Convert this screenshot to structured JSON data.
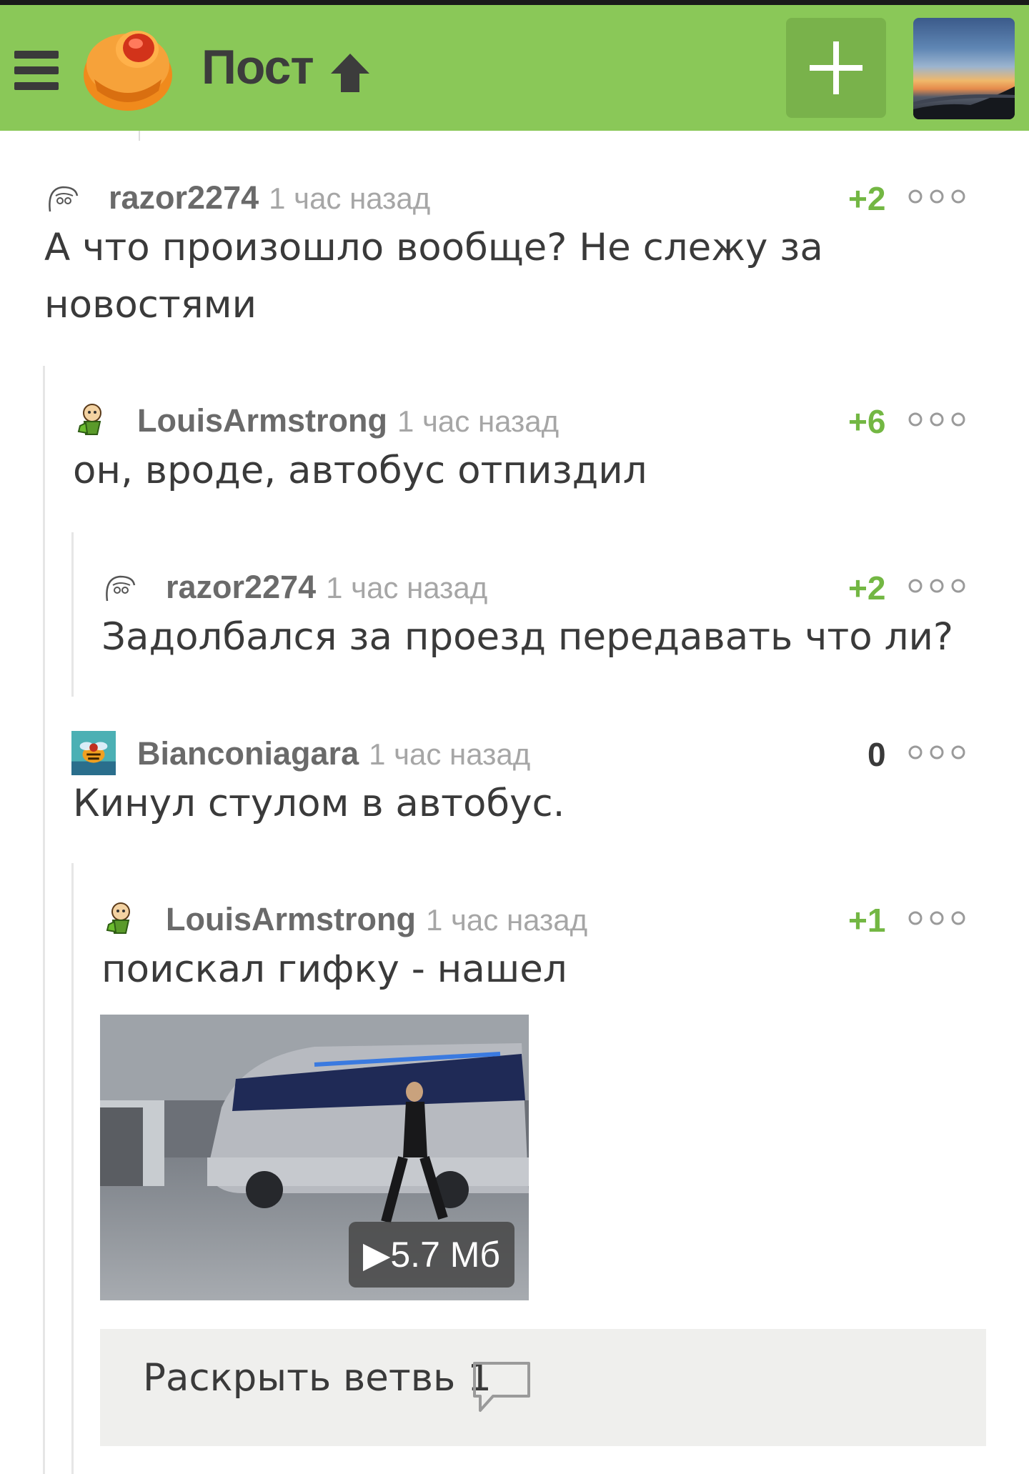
{
  "header": {
    "title": "Пост",
    "menu_icon": "hamburger-icon",
    "logo_icon": "cupcake-logo",
    "arrow_icon": "arrow-up-icon",
    "add_icon": "plus-icon",
    "bg_color": "#8ac858"
  },
  "comments": [
    {
      "author": "razor2274",
      "time": "1 час назад",
      "rating": "+2",
      "text": "А что произошло вообще? Не слежу за новостями",
      "avatar_icon": "face-sketch-avatar"
    },
    {
      "author": "LouisArmstrong",
      "time": "1 час назад",
      "rating": "+6",
      "text": "он, вроде, автобус отпиздил",
      "avatar_icon": "cartoon-man-avatar"
    },
    {
      "author": "razor2274",
      "time": "1 час назад",
      "rating": "+2",
      "text": "Задолбался за проезд передавать что ли?",
      "avatar_icon": "face-sketch-avatar"
    },
    {
      "author": "Bianconiagara",
      "time": "1 час назад",
      "rating": "0",
      "text": "Кинул стулом в автобус.",
      "avatar_icon": "bee-avatar"
    },
    {
      "author": "LouisArmstrong",
      "time": "1 час назад",
      "rating": "+1",
      "text": "поискал гифку - нашел",
      "avatar_icon": "cartoon-man-avatar"
    }
  ],
  "gif": {
    "badge": "▶5.7 Мб"
  },
  "expand": {
    "label": "Раскрыть ветвь 1"
  },
  "colors": {
    "positive_rating": "#73b743",
    "neutral_rating": "#3a3a3a"
  }
}
